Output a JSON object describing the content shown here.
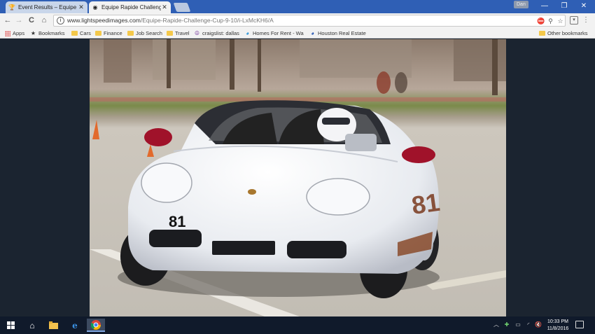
{
  "window": {
    "tabs": [
      {
        "title": "Event Results – Equipe R",
        "active": false,
        "favicon": "trophy-favicon"
      },
      {
        "title": "Equipe Rapide Challenge",
        "active": true,
        "favicon": "camera-favicon"
      }
    ],
    "user_badge": "Dan",
    "controls": {
      "minimize": "—",
      "maximize": "❐",
      "close": "✕"
    }
  },
  "toolbar": {
    "back": "←",
    "forward": "→",
    "reload": "C",
    "home": "⌂",
    "url_host": "www.lightspeedimages.com",
    "url_path": "/Equipe-Rapide-Challenge-Cup-9-10/i-LxMcKH6/A",
    "icons": [
      "block-popup-icon",
      "search-icon",
      "bookmark-star-icon"
    ]
  },
  "bookmarks": {
    "items": [
      {
        "label": "Apps",
        "icon": "apps-grid-icon"
      },
      {
        "label": "Bookmarks",
        "icon": "star-icon"
      },
      {
        "label": "Cars",
        "icon": "folder-icon"
      },
      {
        "label": "Finance",
        "icon": "folder-icon"
      },
      {
        "label": "Job Search",
        "icon": "folder-icon"
      },
      {
        "label": "Travel",
        "icon": "folder-icon"
      },
      {
        "label": "craigslist: dallas",
        "icon": "peace-icon"
      },
      {
        "label": "Homes For Rent - Wa",
        "icon": "globe-icon"
      },
      {
        "label": "Houston Real Estate",
        "icon": "globe-icon"
      }
    ],
    "other": "Other bookmarks"
  },
  "photo": {
    "car_number": "81",
    "colors": {
      "car": "#eef0f4",
      "mirrors": "#a0122a",
      "asphalt": "#c8c4bd",
      "grass": "#7a8a4a"
    }
  },
  "taskbar": {
    "time": "10:33 PM",
    "date": "11/8/2016"
  }
}
